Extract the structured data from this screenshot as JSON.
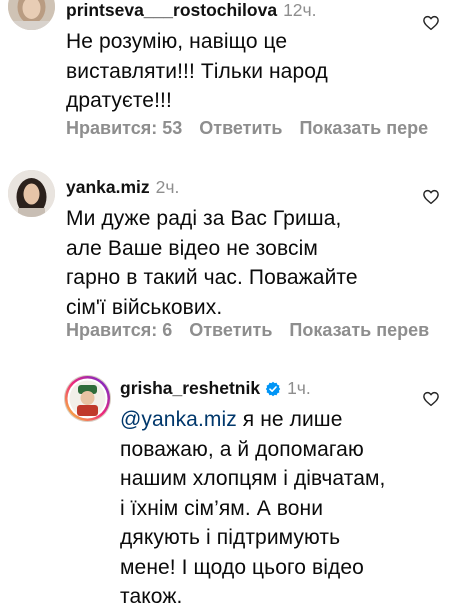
{
  "comments": [
    {
      "username": "printseva___rostochilova",
      "time": "12ч.",
      "text": "Не розумію, навіщо це\nвиставляти!!! Тільки народ\nдратуєте!!!",
      "likes_label": "Нравится: 53",
      "reply_label": "Ответить",
      "translate_label": "Показать пере"
    },
    {
      "username": "yanka.miz",
      "time": "2ч.",
      "text": "Ми дуже раді за Вас Гриша,\nале Ваше відео не зовсім\nгарно в такий час. Поважайте\nсім'ї військових.",
      "likes_label": "Нравится: 6",
      "reply_label": "Ответить",
      "translate_label": "Показать перев"
    },
    {
      "username": "grisha_reshetnik",
      "time": "1ч.",
      "mention": "@yanka.miz",
      "text_first": " я не лише",
      "text_rest": "поважаю, а й допомагаю\nнашим хлопцям і дівчатам,\nі їхнім сім’ям. А вони\nдякують і підтримують\nмене! І щодо цього відео\nтакож."
    }
  ],
  "icons": {
    "heart": "heart-outline-icon",
    "verified": "verified-badge-icon"
  },
  "colors": {
    "meta_gray": "#8e8e8e",
    "mention": "#00376b",
    "verified": "#0095f6"
  }
}
